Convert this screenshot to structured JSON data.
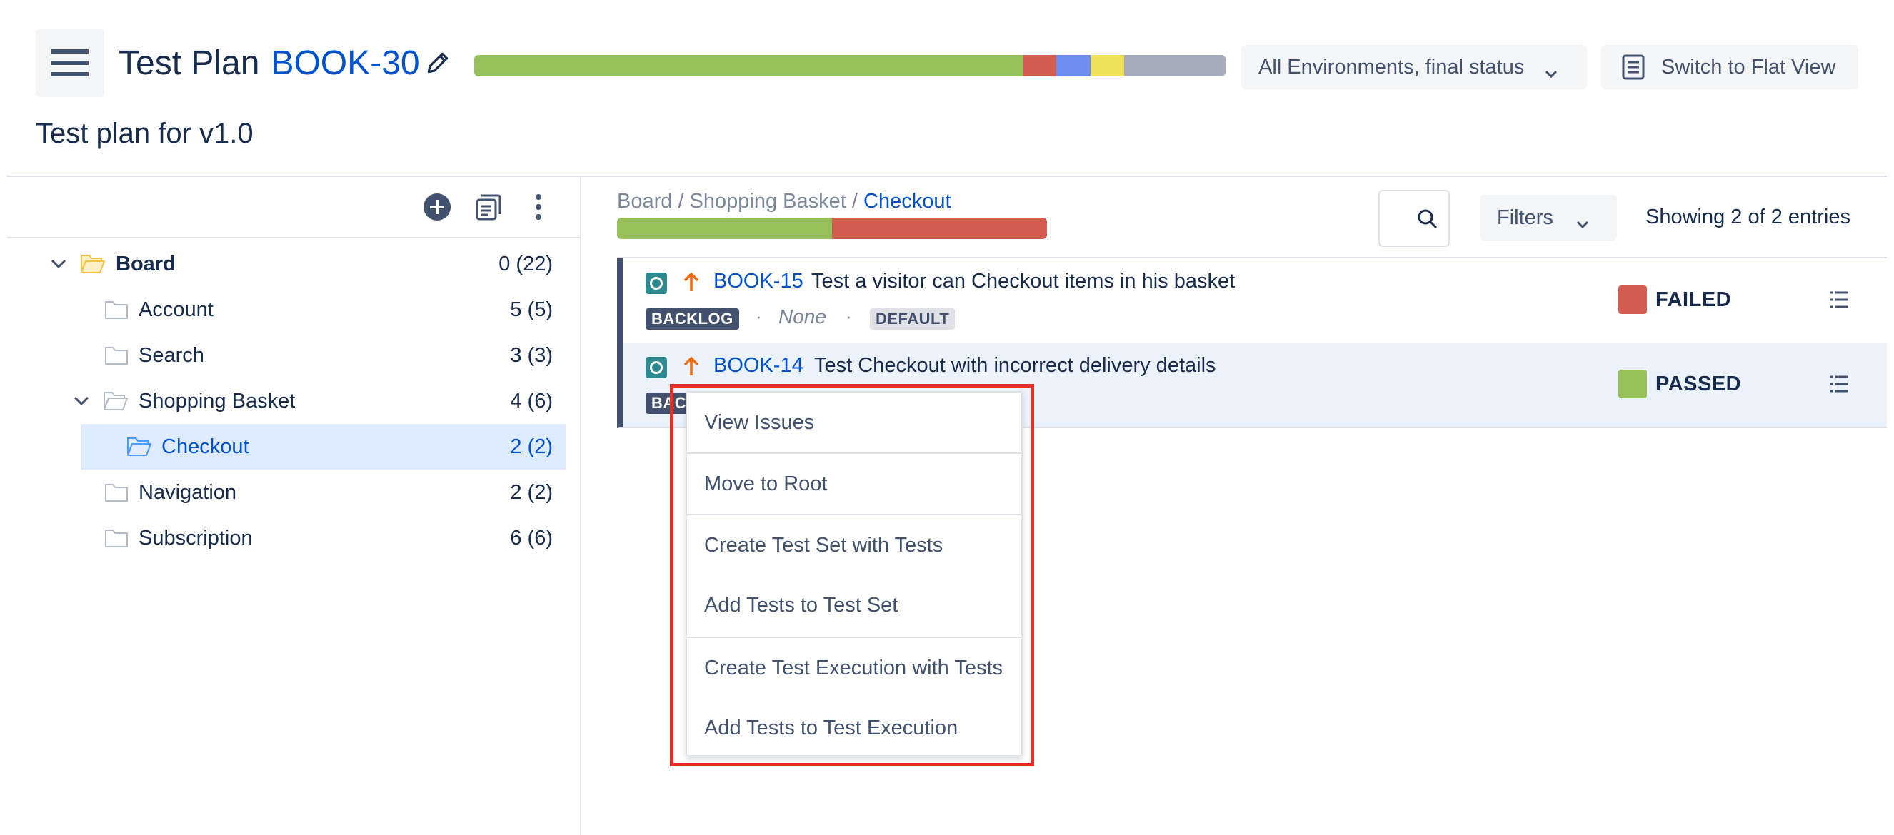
{
  "header": {
    "title": "Test Plan",
    "issue_key": "BOOK-30",
    "subtitle": "Test plan for v1.0",
    "progress": [
      {
        "status": "passed",
        "fraction": 0.73,
        "color": "#97c05c"
      },
      {
        "status": "failed",
        "fraction": 0.045,
        "color": "#d45d52"
      },
      {
        "status": "executing",
        "fraction": 0.045,
        "color": "#6f8cf2"
      },
      {
        "status": "todo",
        "fraction": 0.045,
        "color": "#f0e15b"
      },
      {
        "status": "unknown",
        "fraction": 0.135,
        "color": "#a5adba"
      }
    ],
    "environment_select": "All Environments, final status",
    "flat_view_button": "Switch to Flat View"
  },
  "tree": {
    "items": [
      {
        "label": "Board",
        "count": "0 (22)"
      },
      {
        "label": "Account",
        "count": "5 (5)"
      },
      {
        "label": "Search",
        "count": "3 (3)"
      },
      {
        "label": "Shopping Basket",
        "count": "4 (6)"
      },
      {
        "label": "Checkout",
        "count": "2 (2)"
      },
      {
        "label": "Navigation",
        "count": "2 (2)"
      },
      {
        "label": "Subscription",
        "count": "6 (6)"
      }
    ]
  },
  "breadcrumb": {
    "part1": "Board / Shopping Basket / ",
    "current": "Checkout"
  },
  "folder_progress": [
    {
      "status": "passed",
      "fraction": 0.5,
      "color": "#97c05c"
    },
    {
      "status": "failed",
      "fraction": 0.5,
      "color": "#d45d52"
    }
  ],
  "filters_label": "Filters",
  "showing_text": "Showing 2 of 2 entries",
  "tests": [
    {
      "key": "BOOK-15",
      "summary": "Test a visitor can Checkout items in his basket",
      "status_lozenge": "BACKLOG",
      "separator": "·",
      "assignee": "None",
      "environment": "DEFAULT",
      "result": "FAILED",
      "result_color": "#d45d52"
    },
    {
      "key": "BOOK-14",
      "summary": "Test Checkout with incorrect delivery details",
      "status_lozenge": "BACK",
      "result": "PASSED",
      "result_color": "#97c05c"
    }
  ],
  "context_menu": {
    "items": [
      "View Issues",
      "Move to Root",
      "Create Test Set with Tests",
      "Add Tests to Test Set",
      "Create Test Execution with Tests",
      "Add Tests to Test Execution"
    ]
  }
}
